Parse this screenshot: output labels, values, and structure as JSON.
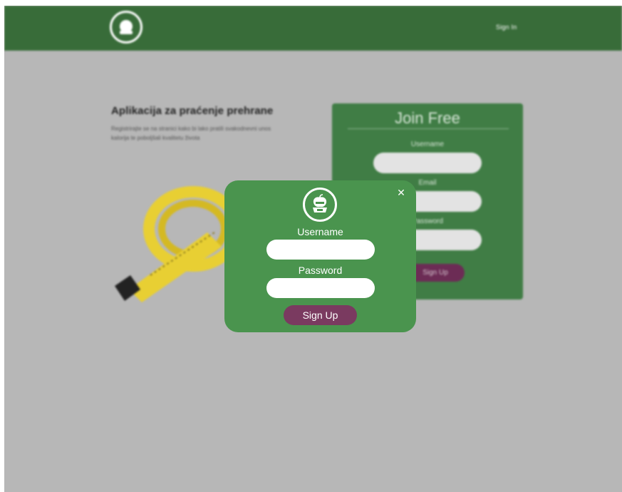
{
  "colors": {
    "header_green": "#386c39",
    "overlay_gray": "#b7b7b7",
    "form_green": "#407d45",
    "modal_green": "#4a944e",
    "button_purple": "#7a3a60",
    "tape_yellow": "#e8cf33"
  },
  "header": {
    "logo_icon": "apple-scale-logo-icon",
    "signin_label": "Sign In"
  },
  "hero": {
    "title": "Aplikacija za praćenje prehrane",
    "text": "Registrirajte se na stranici kako bi lako pratili svakodnevni unos kalorija te poboljšali kvalitetu života"
  },
  "join_form": {
    "title": "Join Free",
    "username_label": "Username",
    "email_label": "Email",
    "password_label": "Password",
    "submit_label": "Sign Up"
  },
  "modal": {
    "logo_icon": "apple-scale-logo-icon",
    "close_icon": "close-icon",
    "close_glyph": "✕",
    "username_label": "Username",
    "username_value": "",
    "password_label": "Password",
    "password_value": "",
    "submit_label": "Sign Up"
  }
}
